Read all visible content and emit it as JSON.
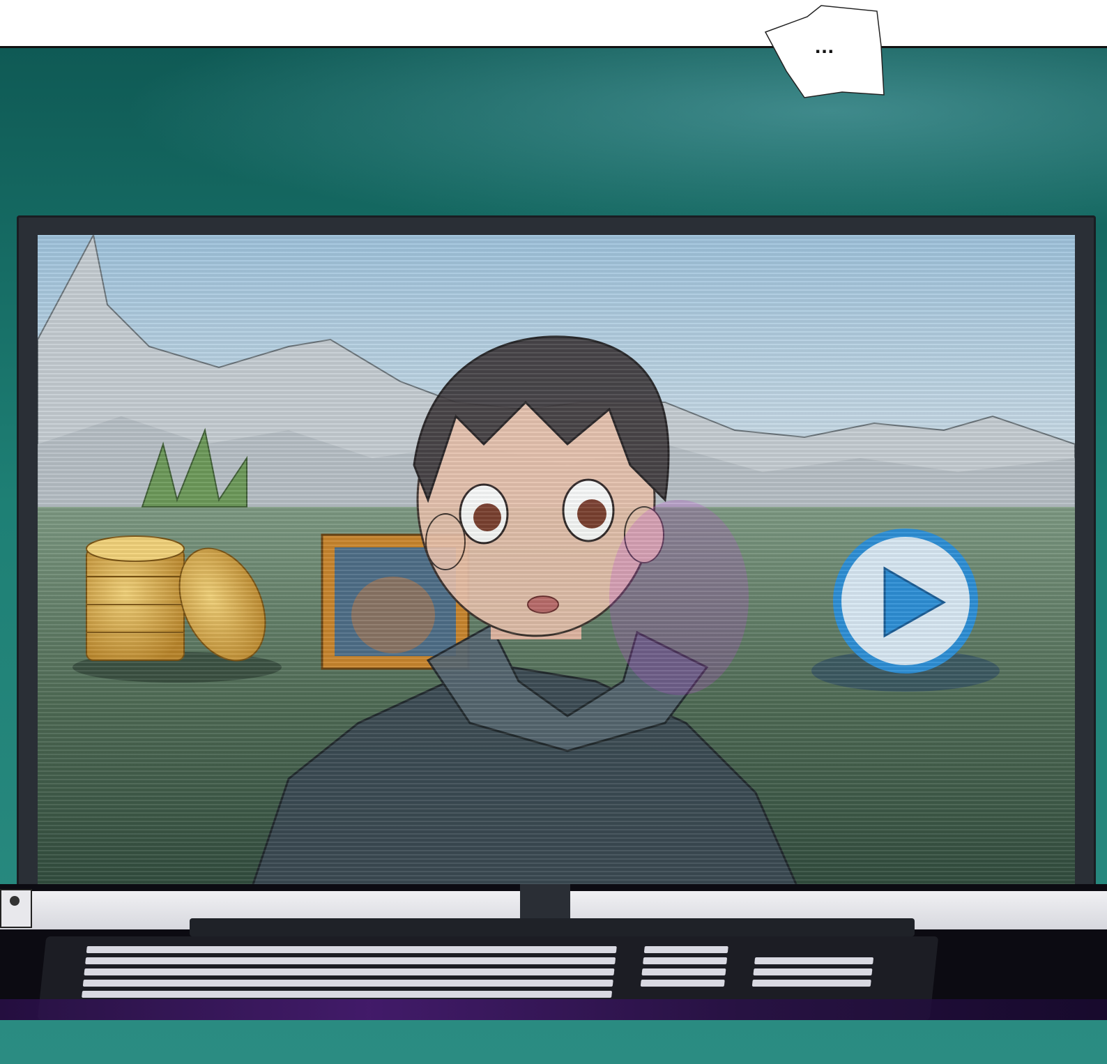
{
  "speech_bubble": {
    "text": "..."
  },
  "icons": {
    "coins": "coin-stack-icon",
    "portrait": "character-portrait-icon",
    "play": "play-button-icon",
    "power": "power-indicator-icon"
  },
  "colors": {
    "wall": "#1e8075",
    "bezel": "#2a2f36",
    "power_light": "#e6e24a",
    "play_blue": "#2e8fd6",
    "coin_gold": "#d9a93a"
  }
}
